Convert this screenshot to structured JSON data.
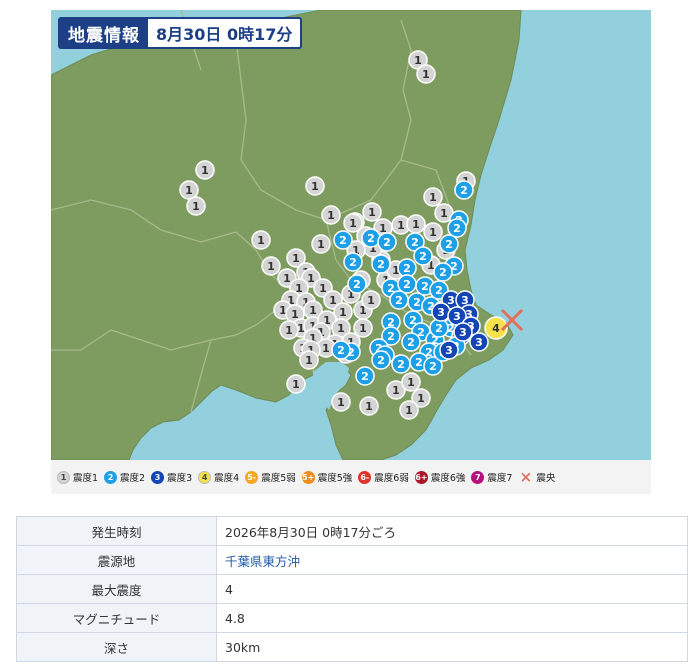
{
  "title": {
    "label": "地震情報",
    "datetime": "8月30日 0時17分"
  },
  "map": {
    "colors": {
      "sea": "#92d0de",
      "land": "#7e9c5f",
      "border": "#a7ba8d",
      "int1": "#d4d4d4",
      "int2": "#1ea0e8",
      "int3": "#1346b4",
      "int4": "#f5e24a",
      "epicenter": "#e0705b"
    },
    "epicenter_symbol": "×",
    "max_marker_label": "4"
  },
  "legend": [
    {
      "badge": "1",
      "label": "震度1",
      "color": "#d4d4d4",
      "text_color": "#444"
    },
    {
      "badge": "2",
      "label": "震度2",
      "color": "#1ea0e8",
      "text_color": "#fff"
    },
    {
      "badge": "3",
      "label": "震度3",
      "color": "#1346b4",
      "text_color": "#fff"
    },
    {
      "badge": "4",
      "label": "震度4",
      "color": "#f5e24a",
      "text_color": "#444"
    },
    {
      "badge": "5-",
      "label": "震度5弱",
      "color": "#f5a623",
      "text_color": "#fff"
    },
    {
      "badge": "5+",
      "label": "震度5強",
      "color": "#f08b1d",
      "text_color": "#fff"
    },
    {
      "badge": "6-",
      "label": "震度6弱",
      "color": "#e0332b",
      "text_color": "#fff"
    },
    {
      "badge": "6+",
      "label": "震度6強",
      "color": "#a8172a",
      "text_color": "#fff"
    },
    {
      "badge": "7",
      "label": "震度7",
      "color": "#b3127c",
      "text_color": "#fff"
    },
    {
      "badge": "×",
      "label": "震央",
      "color": "transparent",
      "text_color": "#e0705b"
    }
  ],
  "info": {
    "rows": [
      {
        "key": "発生時刻",
        "value": "2026年8月30日 0時17分ごろ"
      },
      {
        "key": "震源地",
        "value": "千葉県東方沖",
        "link": true
      },
      {
        "key": "最大震度",
        "value": "4"
      },
      {
        "key": "マグニチュード",
        "value": "4.8"
      },
      {
        "key": "深さ",
        "value": "30km"
      }
    ]
  }
}
